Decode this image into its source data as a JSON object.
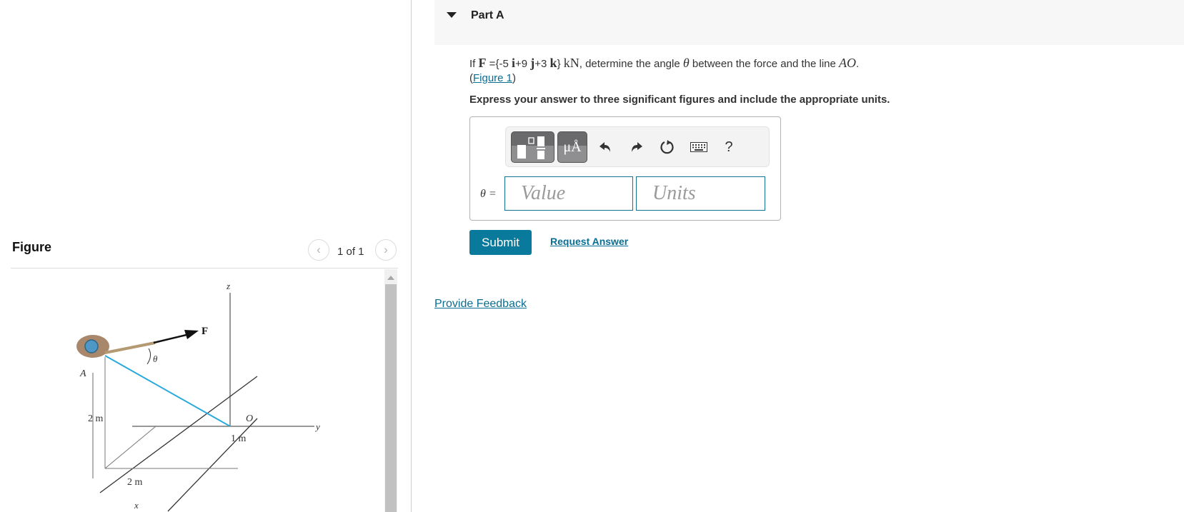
{
  "figure_panel": {
    "title": "Figure",
    "pager": {
      "current": 1,
      "total": 1,
      "text": "1 of 1",
      "prev_icon": "chevron-left-icon",
      "next_icon": "chevron-right-icon"
    },
    "diagram_labels": {
      "z_axis": "z",
      "y_axis": "y",
      "x_axis": "x",
      "force": "F",
      "angle": "θ",
      "point_a": "A",
      "point_o": "O",
      "height_dim": "2 m",
      "x_dim": "2 m",
      "y_dim": "1 m"
    },
    "colors": {
      "line_ao": "#2aa9dd",
      "anchor_rock": "#a8876a",
      "anchor_ring": "#4f97c4"
    }
  },
  "part": {
    "title": "Part A",
    "question": {
      "prefix": "If ",
      "force_symbol": "F",
      "equals": " ={-5 ",
      "i": "i",
      "plus9": "+9 ",
      "j": "j",
      "plus3": "+3 ",
      "k": "k",
      "close": "} ",
      "unit": "kN",
      "middle": ", determine the angle ",
      "theta": "θ",
      "suffix": " between the force and the line ",
      "line": "AO",
      "period": ".",
      "figure_link": "Figure 1"
    },
    "instructions": "Express your answer to three significant figures and include the appropriate units.",
    "toolbar": {
      "templates_icon": "fraction-template-icon",
      "units_label": "μÅ",
      "undo_icon": "undo-icon",
      "redo_icon": "redo-icon",
      "reset_icon": "reset-icon",
      "keyboard_icon": "keyboard-icon",
      "help_label": "?"
    },
    "answer": {
      "variable_label": "θ =",
      "value_placeholder": "Value",
      "value": "",
      "units_placeholder": "Units",
      "units": ""
    },
    "submit_label": "Submit",
    "request_answer_label": "Request Answer"
  },
  "feedback_label": "Provide Feedback",
  "colors": {
    "accent": "#0a7a9c",
    "link": "#0a6d92",
    "header_bg": "#f7f7f7"
  }
}
